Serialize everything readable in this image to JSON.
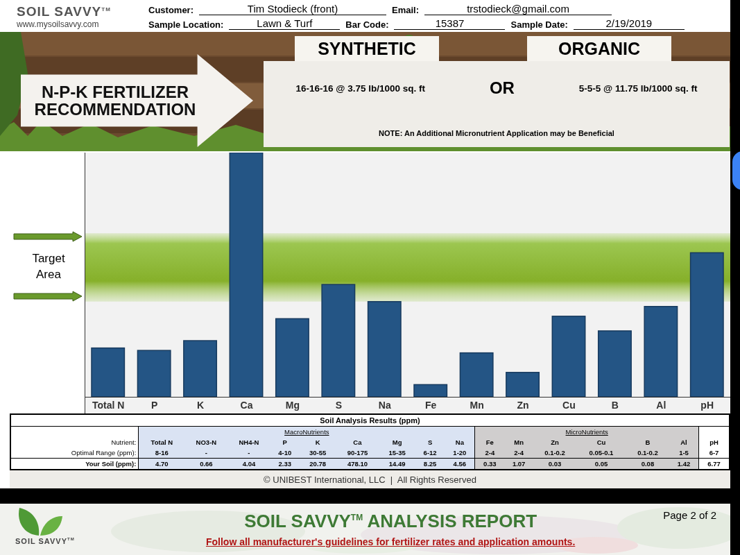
{
  "header": {
    "brand": "SOIL SAVVY$^{TM}$",
    "website": "www.mysoilsavvy.com",
    "field_rows": [
      [
        {
          "label": "Customer:",
          "value": "Tim Stodieck (front)"
        },
        {
          "label": "Email:",
          "value": "trstodieck@gmail.com"
        }
      ],
      [
        {
          "label": "Sample Location:",
          "value": "Lawn & Turf"
        },
        {
          "label": "Bar Code:",
          "value": "15387"
        },
        {
          "label": "Sample Date:",
          "value": "2/19/2019"
        }
      ]
    ]
  },
  "recommendation": {
    "title": "N-P-K FERTILIZER RECOMMENDATION",
    "options": [
      {
        "label": "SYNTHETIC",
        "text": "16-16-16 @ 3.75 lb/1000 sq. ft"
      },
      {
        "label": "ORGANIC",
        "text": "5-5-5 @ 11.75 lb/1000 sq. ft"
      }
    ],
    "separator": "OR",
    "note": "NOTE: An Additional Micronutrient Application may be Beneficial"
  },
  "chart": {
    "target_label": "Target Area",
    "categories": [
      "Total N",
      "P",
      "K",
      "Ca",
      "Mg",
      "S",
      "Na",
      "Fe",
      "Mn",
      "Zn",
      "Cu",
      "B",
      "Al",
      "pH"
    ]
  },
  "table": {
    "title": "Soil Analysis Results (ppm)",
    "row_labels": [
      "Nutrient:",
      "Optimal Range (ppm):",
      "Your Soil (ppm):"
    ],
    "groups": [
      {
        "kind": "macro",
        "name": "MacroNutrients",
        "columns": [
          {
            "nutrient": "Total N",
            "range": "8-16",
            "value": "4.70"
          },
          {
            "nutrient": "NO3-N",
            "range": "-",
            "value": "0.66"
          },
          {
            "nutrient": "NH4-N",
            "range": "-",
            "value": "4.04"
          },
          {
            "nutrient": "P",
            "range": "4-10",
            "value": "2.33"
          },
          {
            "nutrient": "K",
            "range": "30-55",
            "value": "20.78"
          },
          {
            "nutrient": "Ca",
            "range": "90-175",
            "value": "478.10"
          },
          {
            "nutrient": "Mg",
            "range": "15-35",
            "value": "14.49"
          },
          {
            "nutrient": "S",
            "range": "6-12",
            "value": "8.25"
          },
          {
            "nutrient": "Na",
            "range": "1-20",
            "value": "4.56"
          }
        ]
      },
      {
        "kind": "micro",
        "name": "MicroNutrients",
        "columns": [
          {
            "nutrient": "Fe",
            "range": "2-4",
            "value": "0.33"
          },
          {
            "nutrient": "Mn",
            "range": "2-4",
            "value": "1.07"
          },
          {
            "nutrient": "Zn",
            "range": "0.1-0.2",
            "value": "0.03"
          },
          {
            "nutrient": "Cu",
            "range": "0.05-0.1",
            "value": "0.05"
          },
          {
            "nutrient": "B",
            "range": "0.1-0.2",
            "value": "0.08"
          },
          {
            "nutrient": "Al",
            "range": "1-5",
            "value": "1.42"
          }
        ]
      },
      {
        "kind": "plain",
        "columns": [
          {
            "nutrient": "pH",
            "range": "6-7",
            "value": "6.77"
          }
        ]
      }
    ]
  },
  "footer": "© UNIBEST International, LLC  |  All Rights Reserved",
  "next_page": {
    "brand": "SOIL SAVVY$^{TM}$",
    "title": "SOIL SAVVY$^{TM}$ ANALYSIS REPORT",
    "warning": "Follow  all manufacturer's guidelines for fertilizer rates and application amounts.",
    "page": "Page 2 of 2"
  }
}
